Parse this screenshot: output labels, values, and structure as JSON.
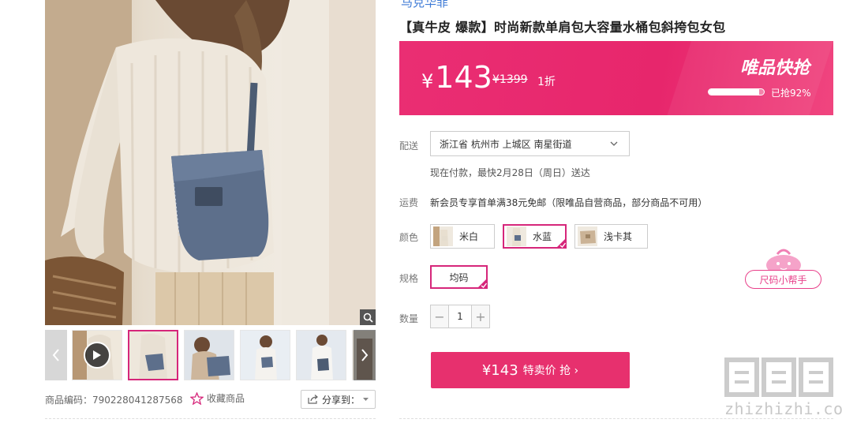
{
  "brand": "马克华菲",
  "product": {
    "title": "【真牛皮 爆款】时尚新款单肩包大容量水桶包斜挎包女包"
  },
  "price_banner": {
    "currency": "¥",
    "price": "143",
    "original_price": "¥1399",
    "discount": "1折",
    "flash_title": "唯品快抢",
    "sold_percent": 92,
    "sold_text": "已抢92%"
  },
  "delivery": {
    "label": "配送",
    "address": "浙江省 杭州市 上城区 南星街道",
    "note": "现在付款，最快2月28日（周日）送达"
  },
  "freight": {
    "label": "运费",
    "text": "新会员专享首单满38元免邮（限唯品自营商品，部分商品不可用）"
  },
  "color": {
    "label": "颜色",
    "options": [
      {
        "name": "米白",
        "selected": false
      },
      {
        "name": "水蓝",
        "selected": true
      },
      {
        "name": "浅卡其",
        "selected": false
      }
    ]
  },
  "spec": {
    "label": "规格",
    "options": [
      {
        "name": "均码",
        "selected": true
      }
    ]
  },
  "quantity": {
    "label": "数量",
    "value": "1",
    "minus": "−",
    "plus": "+"
  },
  "buy_button": {
    "price": "¥143",
    "text": "特卖价 抢 ›"
  },
  "size_helper": "尺码小帮手",
  "meta": {
    "sku_code": "商品编码：790228041287568",
    "favorite": "收藏商品",
    "share": "分享到："
  },
  "watermark": {
    "logo": "值值值",
    "url": "zhizhizhi.com"
  },
  "colors": {
    "accent": "#d6267a",
    "banner": "#e7266c",
    "buy_button": "#e7306e",
    "brand_link": "#3d7ad6"
  },
  "icons": [
    "zoom-icon",
    "play-icon",
    "chevron-left-icon",
    "chevron-right-icon",
    "star-icon",
    "share-icon",
    "chevron-down-icon",
    "check-icon"
  ]
}
